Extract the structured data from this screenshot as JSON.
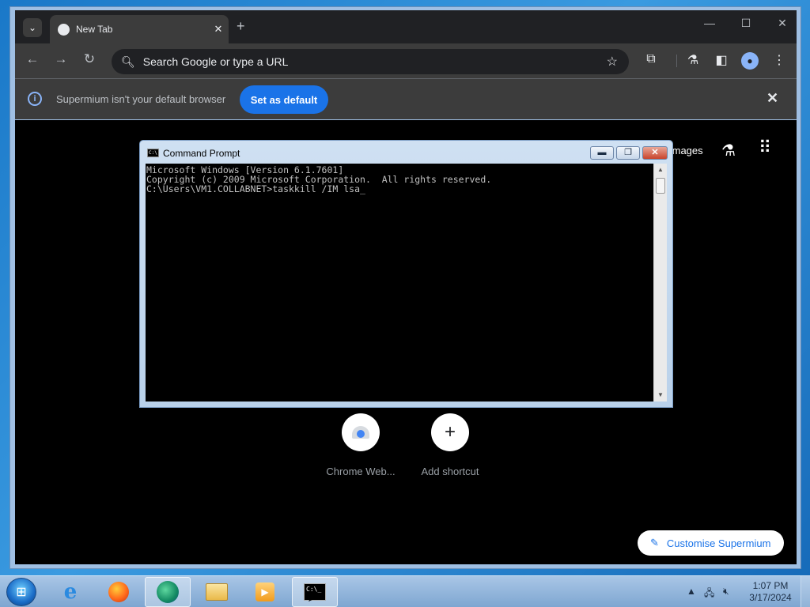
{
  "browser": {
    "tab": {
      "title": "New Tab",
      "close_glyph": "✕"
    },
    "new_tab_glyph": "+",
    "window_controls": {
      "minimize": "—",
      "maximize": "☐",
      "close": "✕"
    },
    "toolbar": {
      "back_glyph": "←",
      "forward_glyph": "→",
      "reload_glyph": "↻",
      "omnibox_placeholder": "Search Google or type a URL",
      "icons": [
        "search-icon",
        "bookmark-star-icon",
        "extensions-icon",
        "labs-icon",
        "side-panel-icon",
        "profile-icon",
        "menu-icon"
      ]
    },
    "infobar": {
      "message": "Supermium isn't your default browser",
      "button_label": "Set as default",
      "close_glyph": "✕"
    },
    "ntp": {
      "images_link": "Images",
      "shortcuts": [
        {
          "label": "Chrome Web..."
        },
        {
          "label": "Add shortcut",
          "glyph": "+"
        }
      ],
      "customise_label": "Customise Supermium"
    }
  },
  "cmd": {
    "title": "Command Prompt",
    "lines": [
      "Microsoft Windows [Version 6.1.7601]",
      "Copyright (c) 2009 Microsoft Corporation.  All rights reserved.",
      "",
      "C:\\Users\\VM1.COLLABNET>taskkill /IM lsa"
    ],
    "caret": "_"
  },
  "taskbar": {
    "apps": [
      "internet-explorer",
      "firefox",
      "edge",
      "file-explorer",
      "media-player",
      "command-prompt"
    ],
    "clock": {
      "time": "1:07 PM",
      "date": "3/17/2024"
    }
  },
  "colors": {
    "accent": "#1a73e8",
    "chrome_dark": "#3c3c3c",
    "console_text": "#c0c0c0"
  }
}
